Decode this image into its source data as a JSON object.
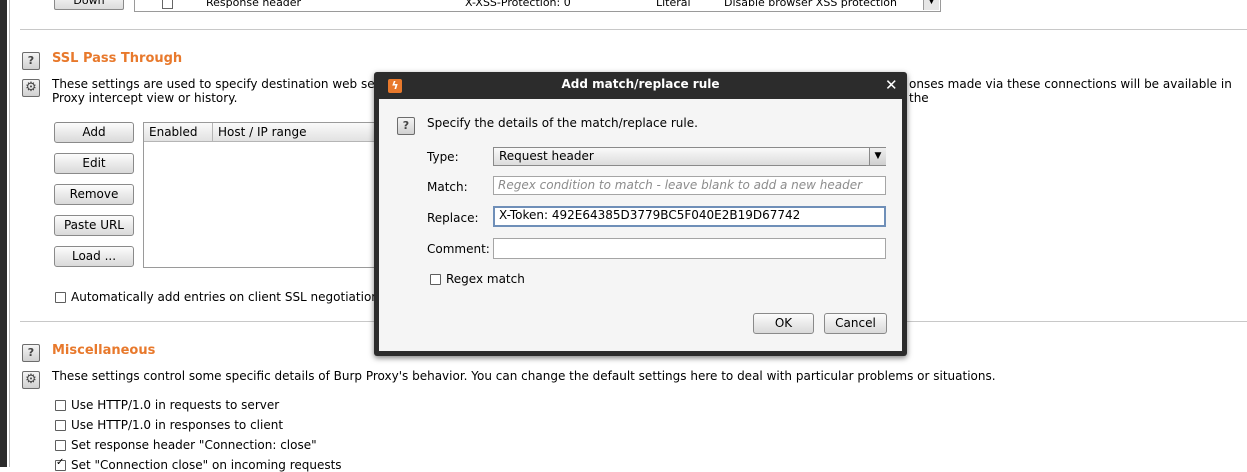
{
  "top_remnant": {
    "button_label": "Down",
    "row": {
      "type": "Response header",
      "match": "X-XSS-Protection: 0",
      "kind": "Literal",
      "comment": "Disable browser XSS protection"
    }
  },
  "ssl": {
    "title": "SSL Pass Through",
    "description_line1": "These settings are used to specify destination web server",
    "description_line1_right": "onses made via these connections will be available in the",
    "description_line2": "Proxy intercept view or history.",
    "buttons": [
      "Add",
      "Edit",
      "Remove",
      "Paste URL",
      "Load ..."
    ],
    "table_headers": [
      "Enabled",
      "Host / IP range"
    ],
    "auto_add_label": "Automatically add entries on client SSL negotiation fail"
  },
  "misc": {
    "title": "Miscellaneous",
    "description": "These settings control some specific details of Burp Proxy's behavior. You can change the default settings here to deal with particular problems or situations.",
    "options": [
      {
        "label": "Use HTTP/1.0 in requests to server",
        "checked": false
      },
      {
        "label": "Use HTTP/1.0 in responses to client",
        "checked": false
      },
      {
        "label": "Set response header \"Connection: close\"",
        "checked": false
      },
      {
        "label": "Set \"Connection close\" on incoming requests",
        "checked": true
      }
    ]
  },
  "dialog": {
    "title": "Add match/replace rule",
    "close_glyph": "✕",
    "intro": "Specify the details of the match/replace rule.",
    "type_label": "Type:",
    "type_value": "Request header",
    "match_label": "Match:",
    "match_placeholder": "Regex condition to match - leave blank to add a new header",
    "replace_label": "Replace:",
    "replace_value": "X-Token: 492E64385D3779BC5F040E2B19D67742",
    "comment_label": "Comment:",
    "comment_value": "",
    "regex_label": "Regex match",
    "ok_label": "OK",
    "cancel_label": "Cancel"
  },
  "colors": {
    "accent": "#e8792c",
    "title_bar": "#2c2c2c"
  }
}
